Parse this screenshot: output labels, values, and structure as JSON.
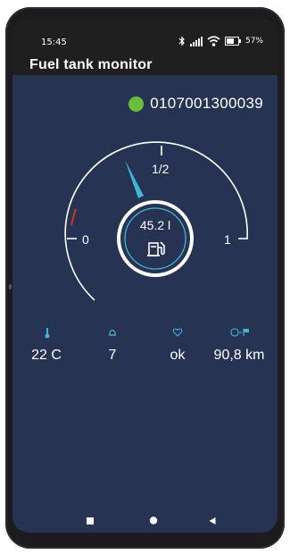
{
  "status_bar": {
    "time": "15:45",
    "battery": "57%"
  },
  "app": {
    "title": "Fuel tank monitor"
  },
  "device": {
    "id": "0107001300039",
    "status_color": "#6abf3a"
  },
  "gauge": {
    "fuel_value": "45.2 l",
    "label_empty": "0",
    "label_half": "1/2",
    "label_full": "1",
    "needle_fraction": 0.42,
    "accent_color": "#3fb6d6",
    "warning_color": "#d0342c",
    "icon": "fuel-pump-icon"
  },
  "stats": [
    {
      "icon": "thermometer-icon",
      "value": "22 C"
    },
    {
      "icon": "bell-icon",
      "value": "7"
    },
    {
      "icon": "heart-icon",
      "value": "ok"
    },
    {
      "icon": "route-distance-icon",
      "value": "90,8 km"
    }
  ],
  "nav": {
    "back_icon": "back-triangle-icon",
    "home_icon": "home-circle-icon",
    "recents_icon": "recents-square-icon"
  }
}
